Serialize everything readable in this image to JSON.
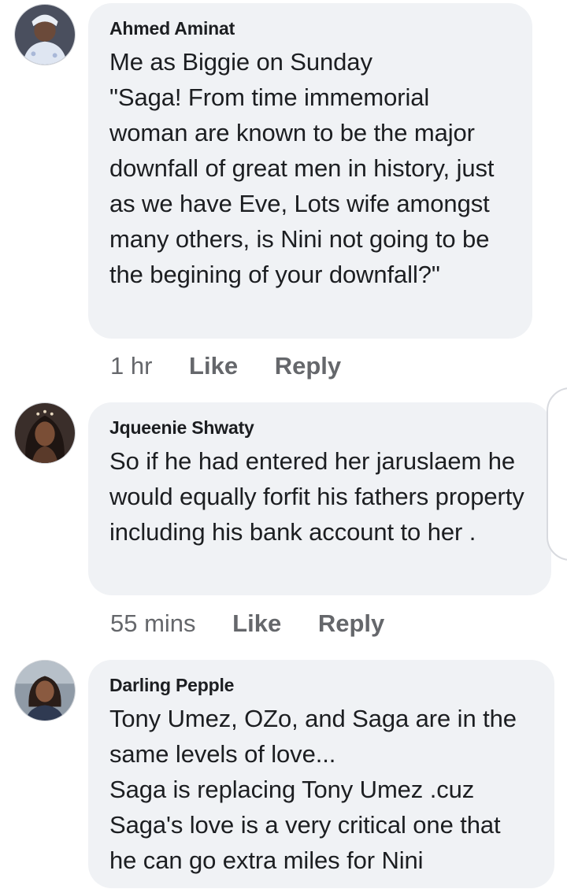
{
  "comments": [
    {
      "author": "Ahmed Aminat",
      "text": "Me as Biggie on Sunday\n\"Saga! From time immemorial woman are known to be the major downfall of great men in history, just as we have Eve, Lots wife amongst many others, is Nini not going to be the begining of your downfall?\"",
      "time": "1 hr",
      "like_label": "Like",
      "reply_label": "Reply"
    },
    {
      "author": "Jqueenie Shwaty",
      "text": "So if he had entered her jaruslaem he would equally forfit his fathers property including his bank account to her .",
      "time": "55 mins",
      "like_label": "Like",
      "reply_label": "Reply"
    },
    {
      "author": "Darling Pepple",
      "text": "Tony Umez, OZo, and Saga are in the same levels of love...\nSaga is replacing Tony Umez .cuz Saga's love is a very critical one that he can go  extra miles for Nini",
      "time": "",
      "like_label": "",
      "reply_label": ""
    }
  ],
  "colors": {
    "bubble_bg": "#f0f2f5",
    "text": "#1c1e21",
    "meta": "#65676b"
  }
}
